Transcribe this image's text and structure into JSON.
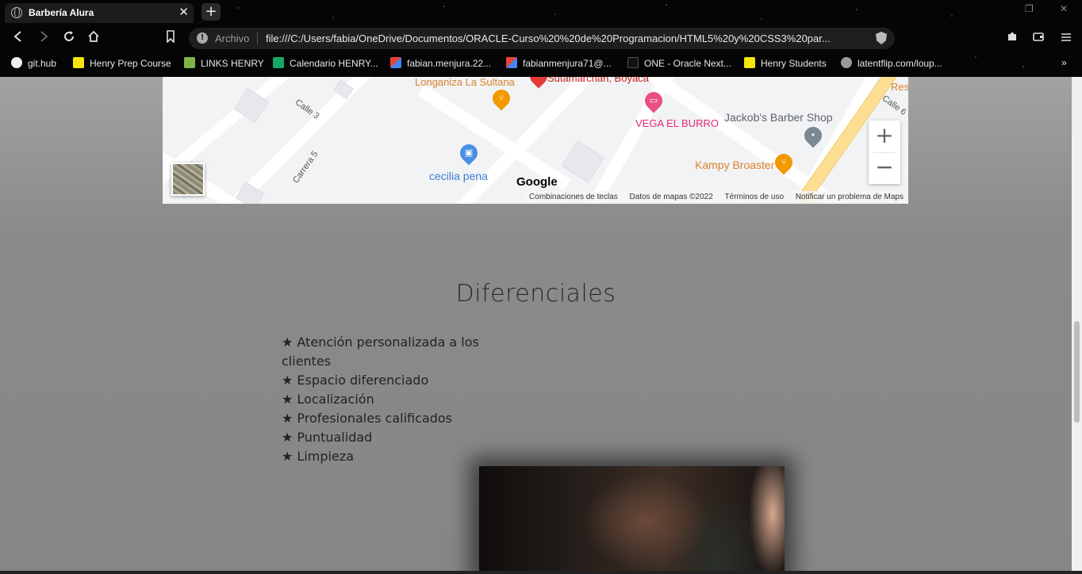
{
  "browser": {
    "tab_title": "Barbería Alura",
    "address_prefix": "Archivo",
    "address_url": "file:///C:/Users/fabia/OneDrive/Documentos/ORACLE-Curso%20%20de%20Programacion/HTML5%20y%20CSS3%20par...",
    "bookmarks": [
      {
        "label": "git.hub",
        "icon": "github-icon"
      },
      {
        "label": "Henry Prep Course",
        "icon": "henry-icon"
      },
      {
        "label": "LINKS HENRY",
        "icon": "notebook-icon"
      },
      {
        "label": "Calendario HENRY...",
        "icon": "sheets-icon"
      },
      {
        "label": "fabian.menjura.22...",
        "icon": "gmail-icon"
      },
      {
        "label": "fabianmenjura71@...",
        "icon": "gmail-icon"
      },
      {
        "label": "ONE - Oracle Next...",
        "icon": "alura-icon"
      },
      {
        "label": "Henry Students",
        "icon": "henry-icon"
      },
      {
        "label": "latentflip.com/loup...",
        "icon": "globe-icon"
      }
    ]
  },
  "map": {
    "labels": {
      "longaniza": "Longaniza La Sultana",
      "sutamarchan": "Sutamarchán, Boyacá",
      "vega": "VEGA EL BURRO",
      "jackob": "Jackob's Barber Shop",
      "cecilia": "cecilia pena",
      "kampy": "Kampy Broaster",
      "calle3": "Calle 3",
      "carrera5": "Carrera 5",
      "calle6": "Calle 6",
      "res": "Res"
    },
    "zoom_in": "+",
    "zoom_out": "−",
    "google_logo": "Google",
    "attribution": {
      "shortcuts": "Combinaciones de teclas",
      "data": "Datos de mapas ©2022",
      "terms": "Términos de uso",
      "report": "Notificar un problema de Maps"
    }
  },
  "section": {
    "title": "Diferenciales",
    "items": [
      "★ Atención personalizada a los clientes",
      "★ Espacio diferenciado",
      "★ Localización",
      "★ Profesionales calificados",
      "★ Puntualidad",
      "★ Limpieza"
    ]
  }
}
